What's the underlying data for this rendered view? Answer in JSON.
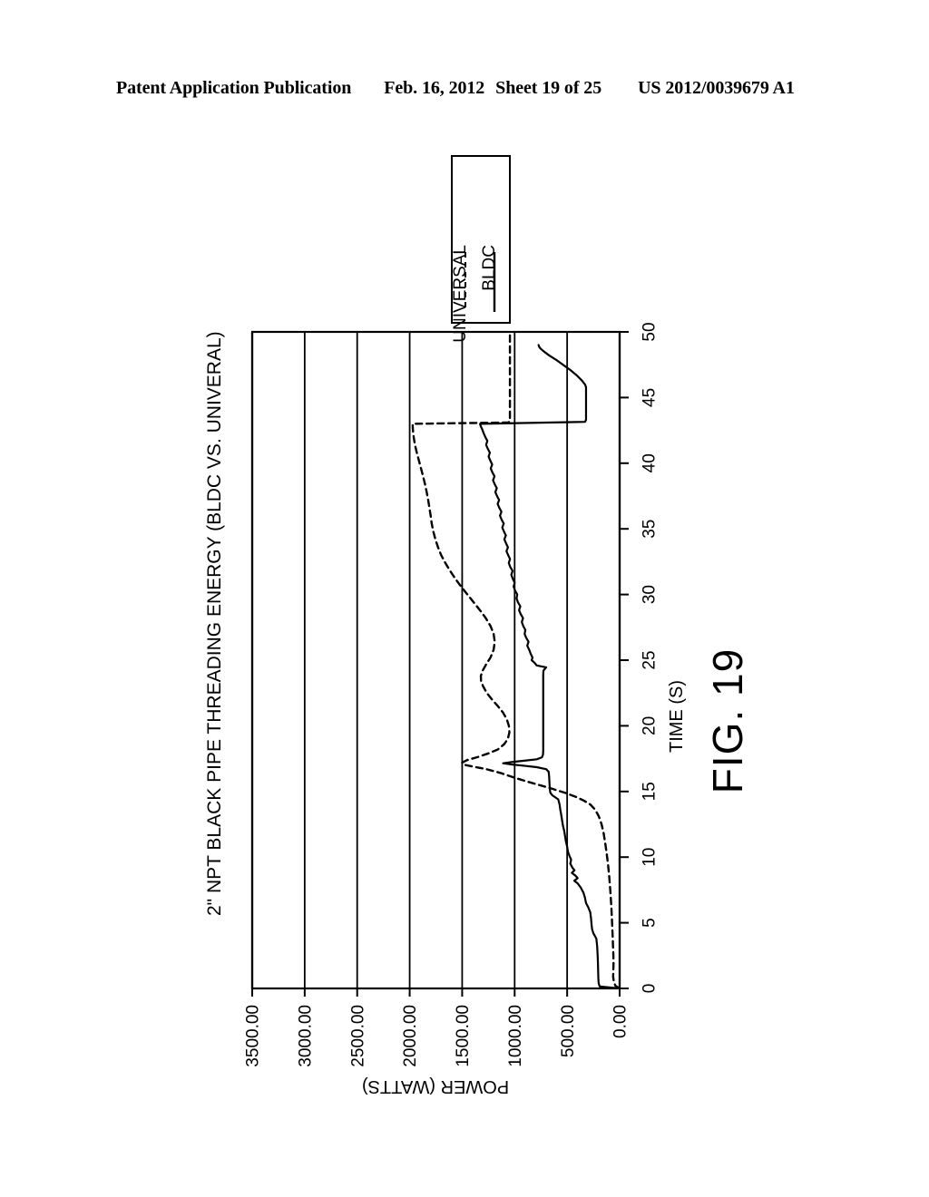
{
  "header": {
    "publication": "Patent Application Publication",
    "date": "Feb. 16, 2012",
    "sheet": "Sheet 19 of 25",
    "number": "US 2012/0039679 A1"
  },
  "figure": {
    "caption": "FIG. 19"
  },
  "chart_data": {
    "type": "line",
    "title": "2\" NPT BLACK PIPE THREADING ENERGY (BLDC VS. UNIVERAL)",
    "orientation": "rotated-90-ccw",
    "xlabel": "TIME (S)",
    "ylabel": "POWER (WATTS)",
    "xlim": [
      0,
      50
    ],
    "ylim": [
      0,
      3500
    ],
    "xticks": [
      0,
      5,
      10,
      15,
      20,
      25,
      30,
      35,
      40,
      45,
      50
    ],
    "xtick_labels": [
      "0",
      "5",
      "10",
      "15",
      "20",
      "25",
      "30",
      "35",
      "40",
      "45",
      "50"
    ],
    "yticks": [
      0,
      500,
      1000,
      1500,
      2000,
      2500,
      3000,
      3500
    ],
    "ytick_labels": [
      "0.00",
      "500.00",
      "1000.00",
      "1500.00",
      "2000.00",
      "2500.00",
      "3000.00",
      "3500.00"
    ],
    "grid": "y-gridlines-only",
    "legend_position": "top-right",
    "line_color": "#000000",
    "series": [
      {
        "name": "UNIVERSAL",
        "style": "dashed",
        "points": [
          [
            0.0,
            0
          ],
          [
            0.2,
            40
          ],
          [
            0.5,
            55
          ],
          [
            0.9,
            62
          ],
          [
            1.4,
            60
          ],
          [
            2.0,
            58
          ],
          [
            2.6,
            60
          ],
          [
            3.2,
            63
          ],
          [
            3.9,
            66
          ],
          [
            4.6,
            70
          ],
          [
            5.4,
            74
          ],
          [
            6.2,
            79
          ],
          [
            7.0,
            85
          ],
          [
            7.8,
            92
          ],
          [
            8.6,
            100
          ],
          [
            9.4,
            110
          ],
          [
            10.2,
            122
          ],
          [
            11.0,
            136
          ],
          [
            11.8,
            152
          ],
          [
            12.5,
            172
          ],
          [
            13.1,
            198
          ],
          [
            13.6,
            232
          ],
          [
            14.0,
            278
          ],
          [
            14.3,
            340
          ],
          [
            14.6,
            420
          ],
          [
            14.9,
            520
          ],
          [
            15.2,
            640
          ],
          [
            15.5,
            770
          ],
          [
            15.8,
            900
          ],
          [
            16.1,
            1020
          ],
          [
            16.4,
            1130
          ],
          [
            16.7,
            1270
          ],
          [
            16.9,
            1400
          ],
          [
            17.05,
            1490
          ],
          [
            17.2,
            1500
          ],
          [
            17.4,
            1450
          ],
          [
            17.6,
            1360
          ],
          [
            17.9,
            1250
          ],
          [
            18.2,
            1160
          ],
          [
            18.6,
            1100
          ],
          [
            19.0,
            1065
          ],
          [
            19.5,
            1050
          ],
          [
            20.0,
            1055
          ],
          [
            20.5,
            1075
          ],
          [
            21.0,
            1110
          ],
          [
            21.5,
            1160
          ],
          [
            22.0,
            1215
          ],
          [
            22.5,
            1265
          ],
          [
            23.0,
            1300
          ],
          [
            23.4,
            1320
          ],
          [
            23.8,
            1322
          ],
          [
            24.2,
            1305
          ],
          [
            24.7,
            1270
          ],
          [
            25.2,
            1230
          ],
          [
            25.8,
            1200
          ],
          [
            26.4,
            1190
          ],
          [
            27.0,
            1200
          ],
          [
            27.6,
            1230
          ],
          [
            28.2,
            1275
          ],
          [
            28.8,
            1330
          ],
          [
            29.4,
            1390
          ],
          [
            30.0,
            1450
          ],
          [
            30.6,
            1510
          ],
          [
            31.2,
            1565
          ],
          [
            31.8,
            1615
          ],
          [
            32.4,
            1660
          ],
          [
            33.0,
            1700
          ],
          [
            33.6,
            1730
          ],
          [
            34.2,
            1755
          ],
          [
            34.8,
            1775
          ],
          [
            35.4,
            1790
          ],
          [
            36.0,
            1800
          ],
          [
            36.6,
            1812
          ],
          [
            37.2,
            1824
          ],
          [
            37.8,
            1838
          ],
          [
            38.4,
            1854
          ],
          [
            39.0,
            1872
          ],
          [
            39.6,
            1892
          ],
          [
            40.2,
            1912
          ],
          [
            40.8,
            1932
          ],
          [
            41.4,
            1950
          ],
          [
            42.0,
            1962
          ],
          [
            42.6,
            1970
          ],
          [
            43.0,
            1972
          ],
          [
            43.1,
            1060
          ],
          [
            43.2,
            1045
          ],
          [
            44.0,
            1045
          ],
          [
            46.0,
            1045
          ],
          [
            48.0,
            1045
          ],
          [
            50.0,
            1045
          ]
        ]
      },
      {
        "name": "BLDC",
        "style": "solid",
        "points": [
          [
            0.0,
            0
          ],
          [
            0.15,
            190
          ],
          [
            0.4,
            200
          ],
          [
            0.8,
            203
          ],
          [
            1.4,
            205
          ],
          [
            2.0,
            207
          ],
          [
            2.6,
            210
          ],
          [
            3.2,
            214
          ],
          [
            3.8,
            222
          ],
          [
            4.2,
            250
          ],
          [
            4.5,
            262
          ],
          [
            4.9,
            268
          ],
          [
            5.3,
            272
          ],
          [
            5.8,
            280
          ],
          [
            6.2,
            300
          ],
          [
            6.5,
            320
          ],
          [
            6.9,
            330
          ],
          [
            7.3,
            345
          ],
          [
            7.7,
            372
          ],
          [
            8.0,
            400
          ],
          [
            8.2,
            432
          ],
          [
            8.4,
            400
          ],
          [
            8.6,
            422
          ],
          [
            8.8,
            455
          ],
          [
            9.0,
            430
          ],
          [
            9.2,
            450
          ],
          [
            9.5,
            470
          ],
          [
            9.8,
            462
          ],
          [
            10.1,
            478
          ],
          [
            10.4,
            492
          ],
          [
            10.8,
            500
          ],
          [
            11.2,
            512
          ],
          [
            11.6,
            520
          ],
          [
            12.0,
            528
          ],
          [
            12.4,
            540
          ],
          [
            12.8,
            548
          ],
          [
            13.2,
            556
          ],
          [
            13.6,
            565
          ],
          [
            14.0,
            572
          ],
          [
            14.4,
            585
          ],
          [
            14.7,
            640
          ],
          [
            14.9,
            660
          ],
          [
            15.1,
            664
          ],
          [
            15.3,
            666
          ],
          [
            15.6,
            668
          ],
          [
            15.9,
            670
          ],
          [
            16.2,
            672
          ],
          [
            16.5,
            676
          ],
          [
            16.7,
            700
          ],
          [
            16.85,
            790
          ],
          [
            16.95,
            900
          ],
          [
            17.05,
            1020
          ],
          [
            17.15,
            1110
          ],
          [
            17.25,
            1020
          ],
          [
            17.35,
            900
          ],
          [
            17.45,
            790
          ],
          [
            17.6,
            740
          ],
          [
            17.8,
            730
          ],
          [
            18.1,
            728
          ],
          [
            18.5,
            728
          ],
          [
            19.0,
            728
          ],
          [
            19.6,
            728
          ],
          [
            20.2,
            728
          ],
          [
            20.8,
            728
          ],
          [
            21.4,
            728
          ],
          [
            22.0,
            728
          ],
          [
            22.6,
            728
          ],
          [
            23.2,
            728
          ],
          [
            23.8,
            728
          ],
          [
            24.2,
            726
          ],
          [
            24.45,
            700
          ],
          [
            24.6,
            790
          ],
          [
            24.8,
            810
          ],
          [
            25.0,
            838
          ],
          [
            25.2,
            830
          ],
          [
            25.5,
            848
          ],
          [
            25.8,
            862
          ],
          [
            26.1,
            880
          ],
          [
            26.4,
            868
          ],
          [
            26.7,
            890
          ],
          [
            27.0,
            905
          ],
          [
            27.3,
            898
          ],
          [
            27.6,
            918
          ],
          [
            27.9,
            932
          ],
          [
            28.2,
            920
          ],
          [
            28.5,
            942
          ],
          [
            28.8,
            958
          ],
          [
            29.1,
            946
          ],
          [
            29.4,
            968
          ],
          [
            29.7,
            982
          ],
          [
            30.0,
            975
          ],
          [
            30.3,
            996
          ],
          [
            30.6,
            1010
          ],
          [
            30.9,
            1000
          ],
          [
            31.2,
            1018
          ],
          [
            31.5,
            1032
          ],
          [
            31.8,
            1020
          ],
          [
            32.1,
            1042
          ],
          [
            32.4,
            1056
          ],
          [
            32.7,
            1044
          ],
          [
            33.0,
            1062
          ],
          [
            33.3,
            1078
          ],
          [
            33.6,
            1064
          ],
          [
            33.9,
            1082
          ],
          [
            34.2,
            1098
          ],
          [
            34.5,
            1084
          ],
          [
            34.8,
            1102
          ],
          [
            35.1,
            1118
          ],
          [
            35.4,
            1104
          ],
          [
            35.7,
            1124
          ],
          [
            36.0,
            1140
          ],
          [
            36.3,
            1126
          ],
          [
            36.6,
            1146
          ],
          [
            36.9,
            1162
          ],
          [
            37.2,
            1148
          ],
          [
            37.5,
            1168
          ],
          [
            37.8,
            1184
          ],
          [
            38.1,
            1170
          ],
          [
            38.4,
            1190
          ],
          [
            38.7,
            1206
          ],
          [
            39.0,
            1192
          ],
          [
            39.3,
            1212
          ],
          [
            39.6,
            1228
          ],
          [
            39.9,
            1214
          ],
          [
            40.2,
            1232
          ],
          [
            40.5,
            1248
          ],
          [
            40.8,
            1236
          ],
          [
            41.1,
            1256
          ],
          [
            41.4,
            1272
          ],
          [
            41.7,
            1260
          ],
          [
            42.0,
            1280
          ],
          [
            42.3,
            1296
          ],
          [
            42.6,
            1310
          ],
          [
            42.8,
            1322
          ],
          [
            43.0,
            1330
          ],
          [
            43.15,
            330
          ],
          [
            43.3,
            320
          ],
          [
            44.0,
            320
          ],
          [
            45.0,
            320
          ],
          [
            45.8,
            320
          ],
          [
            46.0,
            330
          ],
          [
            46.3,
            360
          ],
          [
            46.7,
            410
          ],
          [
            47.1,
            470
          ],
          [
            47.5,
            540
          ],
          [
            47.9,
            610
          ],
          [
            48.2,
            670
          ],
          [
            48.5,
            720
          ],
          [
            48.7,
            750
          ],
          [
            48.85,
            766
          ],
          [
            49.0,
            772
          ]
        ]
      }
    ]
  }
}
